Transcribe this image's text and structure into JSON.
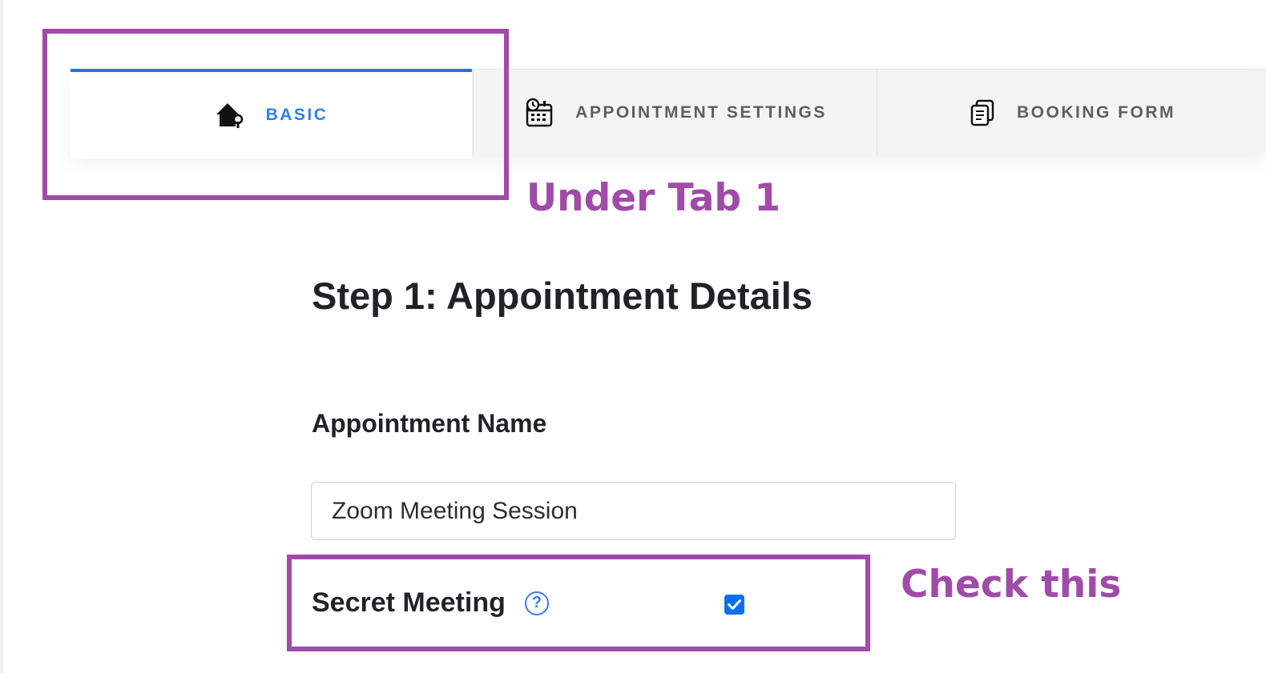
{
  "tabs": {
    "basic": {
      "label": "BASIC",
      "icon": "house-settings-icon",
      "active": true
    },
    "appointment_settings": {
      "label": "APPOINTMENT SETTINGS",
      "icon": "calendar-clock-icon"
    },
    "booking_form": {
      "label": "BOOKING FORM",
      "icon": "form-pages-icon"
    }
  },
  "annotations": {
    "under_tab": "Under Tab 1",
    "check_this": "Check this",
    "color": "#a04ba8"
  },
  "main": {
    "step_title": "Step 1: Appointment Details",
    "appointment_name_label": "Appointment Name",
    "appointment_name_value": "Zoom Meeting Session",
    "secret_meeting_label": "Secret Meeting",
    "secret_meeting_checked": true,
    "help_symbol": "?"
  },
  "colors": {
    "accent": "#1a73e8",
    "checkbox": "#0b6ff3",
    "help": "#3d7be0"
  }
}
